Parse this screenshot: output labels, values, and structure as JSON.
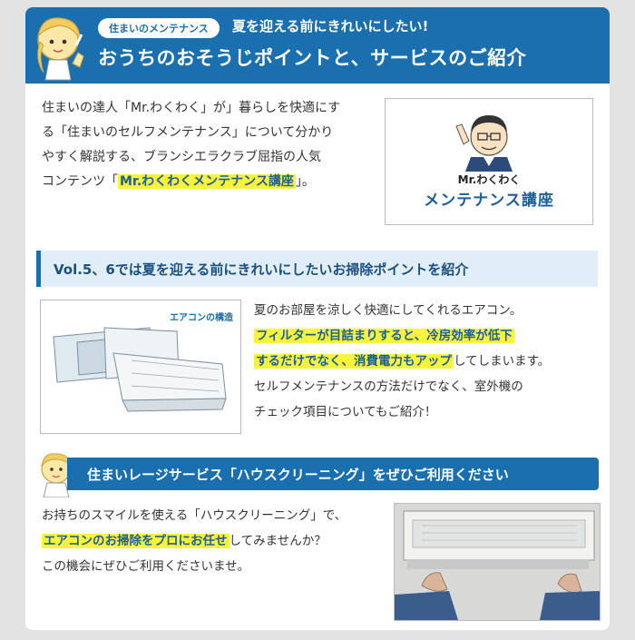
{
  "header": {
    "badge": "住まいのメンテナンス",
    "subtitle": "夏を迎える前にきれいにしたい!",
    "title": "おうちのおそうじポイントと、サービスのご紹介"
  },
  "intro": {
    "line1": "住まいの達人「Mr.わくわく」が」暮らしを快適にす",
    "line2": "る「住まいのセルフメンテナンス」について分かり",
    "line3": "やすく解説する、ブランシエラクラブ屈指の人気",
    "line4_pre": "コンテンツ「",
    "line4_hl": "Mr.わくわくメンテナンス講座",
    "line4_post": "」。"
  },
  "logo": {
    "line1": "Mr.わくわく",
    "line2": "メンテナンス講座"
  },
  "section": {
    "title": "Vol.5、6では夏を迎える前にきれいにしたいお掃除ポイントを紹介"
  },
  "ac": {
    "label": "エアコンの構造",
    "line1": "夏のお部屋を涼しく快適にしてくれるエアコン。",
    "line2_hl": "フィルターが目詰まりすると、冷房効率が低下",
    "line3_hl": "するだけでなく、消費電力もアップ",
    "line3_post": "してしまいます。",
    "line4": "セルフメンテナンスの方法だけでなく、室外機の",
    "line5": "チェック項目についてもご紹介！"
  },
  "service": {
    "title": "住まいレージサービス「ハウスクリーニング」をぜひご利用ください",
    "line1": "お持ちのスマイルを使える「ハウスクリーニング」で、",
    "line2_hl": "エアコンのお掃除をプロにお任せ",
    "line2_post": "してみませんか？",
    "line3": "この機会にぜひご利用くださいませ。"
  },
  "colors": {
    "accent": "#1a6fae",
    "highlight": "#fcf43a",
    "background": "#e3e3e3"
  }
}
